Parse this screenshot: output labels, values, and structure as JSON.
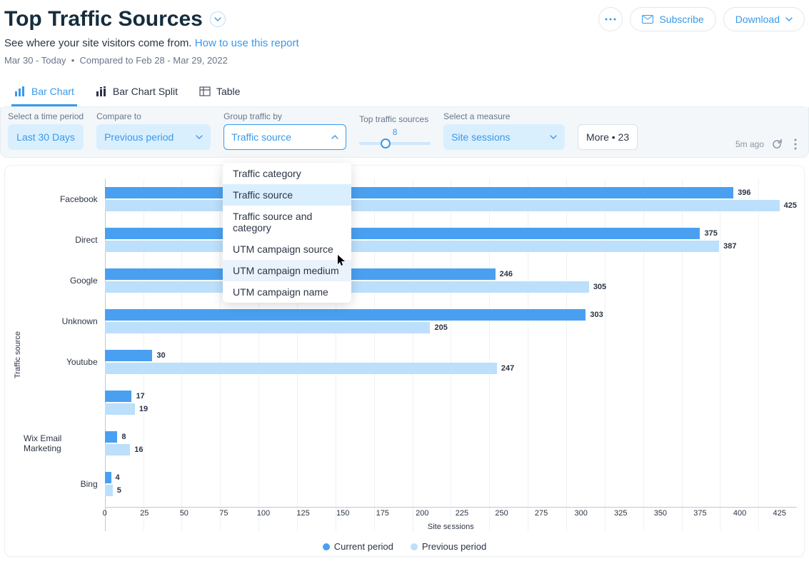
{
  "header": {
    "title": "Top Traffic Sources",
    "subtitle": "See where your site visitors come from.",
    "help_link": "How to use this report",
    "date_range": "Mar 30 - Today",
    "compare_text": "Compared to Feb 28 - Mar 29, 2022",
    "subscribe": "Subscribe",
    "download": "Download"
  },
  "tabs": [
    {
      "id": "bar",
      "label": "Bar Chart",
      "active": true
    },
    {
      "id": "split",
      "label": "Bar Chart Split",
      "active": false
    },
    {
      "id": "table",
      "label": "Table",
      "active": false
    }
  ],
  "controls": {
    "time_label": "Select a time period",
    "time_value": "Last 30 Days",
    "compare_label": "Compare to",
    "compare_value": "Previous period",
    "group_label": "Group traffic by",
    "group_value": "Traffic source",
    "group_options": [
      "Traffic category",
      "Traffic source",
      "Traffic source and category",
      "UTM campaign source",
      "UTM campaign medium",
      "UTM campaign name"
    ],
    "top_label": "Top traffic sources",
    "top_value": "8",
    "measure_label": "Select a measure",
    "measure_value": "Site sessions",
    "more_label": "More • 23",
    "updated": "5m ago"
  },
  "chart_data": {
    "type": "bar",
    "orientation": "horizontal",
    "ylabel": "Traffic source",
    "xlabel": "Site sessions",
    "xlim": [
      0,
      425
    ],
    "xticks": [
      0,
      25,
      50,
      75,
      100,
      125,
      150,
      175,
      200,
      225,
      250,
      275,
      300,
      325,
      350,
      375,
      400,
      425
    ],
    "categories": [
      "Facebook",
      "Direct",
      "Google",
      "Unknown",
      "Youtube",
      "",
      "Wix Email Marketing",
      "Bing"
    ],
    "series": [
      {
        "name": "Current period",
        "color": "#4aa0f0",
        "values": [
          396,
          375,
          246,
          303,
          30,
          17,
          8,
          4
        ]
      },
      {
        "name": "Previous period",
        "color": "#bcdffb",
        "values": [
          425,
          387,
          305,
          205,
          247,
          19,
          16,
          5
        ]
      }
    ]
  },
  "legend": {
    "current": "Current period",
    "previous": "Previous period"
  }
}
